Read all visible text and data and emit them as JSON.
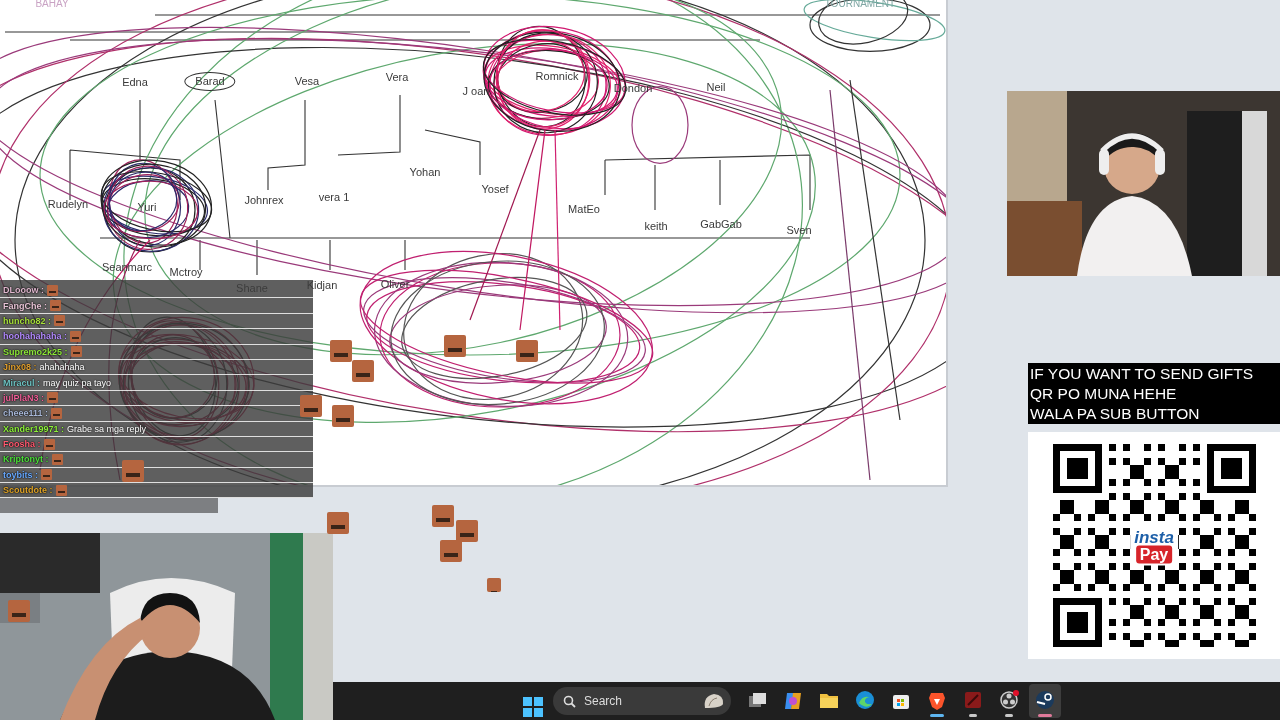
{
  "whiteboard": {
    "labels": [
      {
        "text": "BAHAY",
        "kind": "heading",
        "color": "#c9a3c4"
      },
      {
        "text": "TOURNAMENT",
        "kind": "heading",
        "color": "#7fa6a3"
      },
      {
        "text": "Edna",
        "kind": "name"
      },
      {
        "text": "Barad",
        "kind": "circled"
      },
      {
        "text": "Vesa",
        "kind": "name"
      },
      {
        "text": "Vera",
        "kind": "name"
      },
      {
        "text": "J oan",
        "kind": "name"
      },
      {
        "text": "Romnick",
        "kind": "name"
      },
      {
        "text": "Dondon",
        "kind": "name"
      },
      {
        "text": "Neil",
        "kind": "name"
      },
      {
        "text": "Rudelyn",
        "kind": "name"
      },
      {
        "text": "Yuri",
        "kind": "name"
      },
      {
        "text": "Johnrex",
        "kind": "name"
      },
      {
        "text": "vera 1",
        "kind": "name"
      },
      {
        "text": "Yohan",
        "kind": "name"
      },
      {
        "text": "Yosef",
        "kind": "name"
      },
      {
        "text": "MatEo",
        "kind": "name"
      },
      {
        "text": "keith",
        "kind": "name"
      },
      {
        "text": "GabGab",
        "kind": "name"
      },
      {
        "text": "Sven",
        "kind": "name"
      },
      {
        "text": "Seanmarc",
        "kind": "name"
      },
      {
        "text": "Mctroy",
        "kind": "name"
      },
      {
        "text": "Shane",
        "kind": "name"
      },
      {
        "text": "Kidjan",
        "kind": "name"
      },
      {
        "text": "Oliver",
        "kind": "name"
      }
    ]
  },
  "chat": {
    "messages": [
      {
        "user": "DLooow :",
        "color": "#e0b8cf",
        "kind": "emote"
      },
      {
        "user": "FangChe :",
        "color": "#e8c4d6",
        "kind": "emote"
      },
      {
        "user": "huncho82 :",
        "color": "#a8e03c",
        "kind": "emote"
      },
      {
        "user": "hoohahahaha :",
        "color": "#b48cff",
        "kind": "emote"
      },
      {
        "user": "Supremo2k25 :",
        "color": "#8ee83a",
        "kind": "emote"
      },
      {
        "user": "Jinx08 :",
        "color": "#e0a030",
        "kind": "text",
        "text": "ahahahaha"
      },
      {
        "user": "Miracul :",
        "color": "#6fc4c4",
        "kind": "text",
        "text": "may quiz pa tayo"
      },
      {
        "user": "julPlaN3 :",
        "color": "#f06098",
        "kind": "emote"
      },
      {
        "user": "cheee111 :",
        "color": "#a8b8d8",
        "kind": "emote"
      },
      {
        "user": "Xander19971 :",
        "color": "#8ef03c",
        "kind": "text",
        "text": "Grabe sa mga reply"
      },
      {
        "user": "Foosha :",
        "color": "#ff5a70",
        "kind": "emote"
      },
      {
        "user": "Kriptonyt :",
        "color": "#4ee03c",
        "kind": "emote"
      },
      {
        "user": "toybits :",
        "color": "#6aaaff",
        "kind": "emote"
      },
      {
        "user": "Scoutdote :",
        "color": "#e0a428",
        "kind": "emote"
      }
    ]
  },
  "donation": {
    "lines": [
      "IF YOU WANT TO SEND GIFTS",
      "QR PO MUNA HEHE",
      "WALA PA SUB BUTTON"
    ],
    "logo": [
      "insta",
      "Pay"
    ]
  },
  "taskbar": {
    "search": {
      "placeholder": "Search"
    },
    "apps": [
      {
        "kind": "taskview",
        "running": false,
        "focused": false,
        "highlighted": false
      },
      {
        "kind": "copilot",
        "running": false,
        "focused": false,
        "highlighted": false
      },
      {
        "kind": "folder",
        "running": false,
        "focused": false,
        "highlighted": false
      },
      {
        "kind": "edge",
        "running": false,
        "focused": false,
        "highlighted": false
      },
      {
        "kind": "store",
        "running": false,
        "focused": false,
        "highlighted": false
      },
      {
        "kind": "brave",
        "running": true,
        "focused": true,
        "highlighted": false
      },
      {
        "kind": "game",
        "running": true,
        "focused": false,
        "highlighted": false
      },
      {
        "kind": "obs",
        "running": true,
        "focused": false,
        "highlighted": false
      },
      {
        "kind": "steam",
        "running": true,
        "focused": true,
        "highlighted": true
      }
    ]
  }
}
